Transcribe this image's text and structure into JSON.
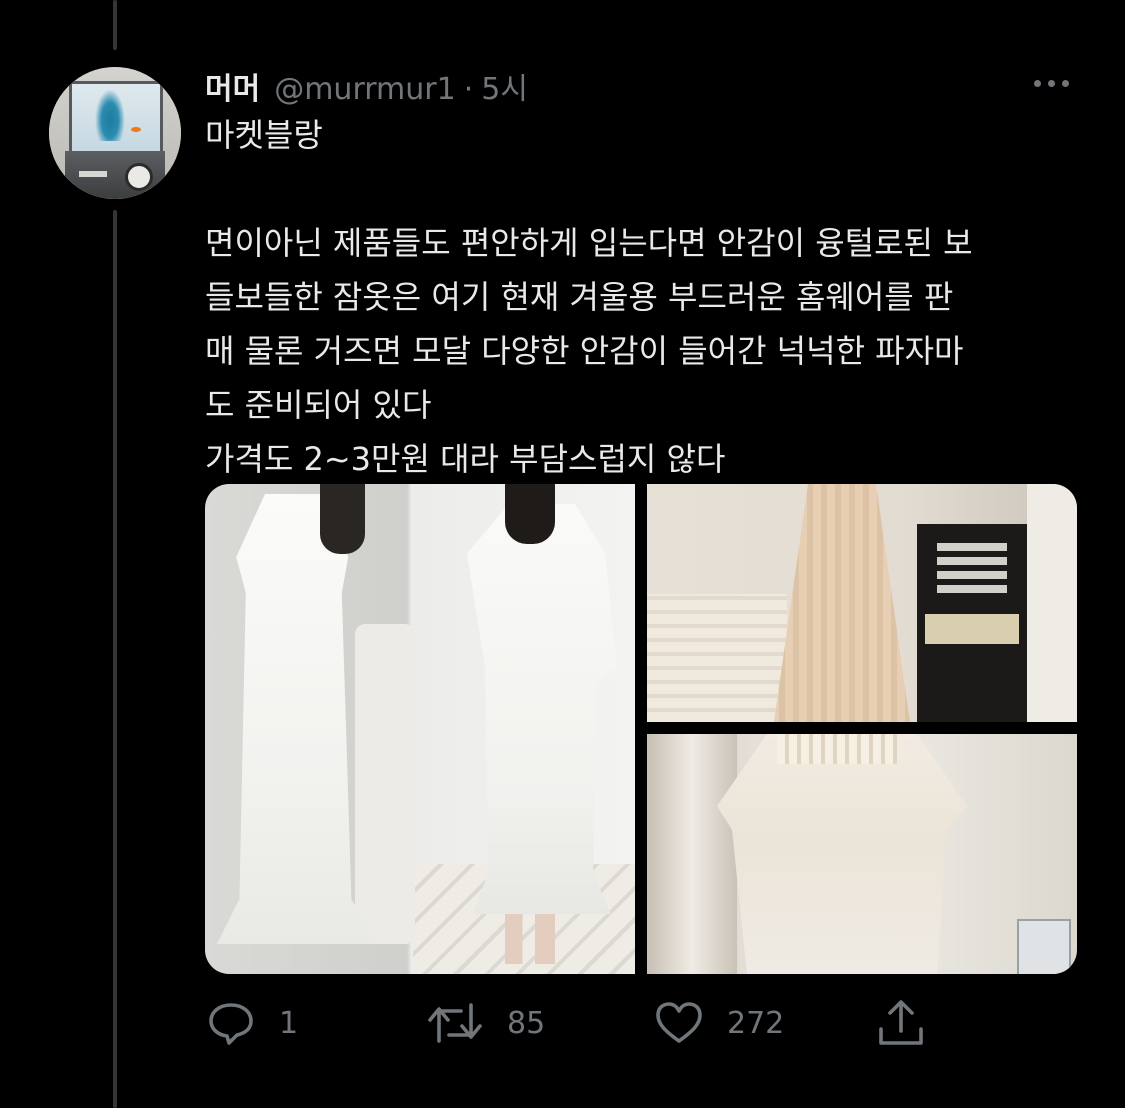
{
  "tweet": {
    "display_name": "머머",
    "handle": "@murrmur1",
    "separator": "·",
    "time": "5시",
    "lines": [
      "마켓블랑",
      "",
      "면이아닌 제품들도 편안하게 입는다면 안감이 융털로된 보",
      "들보들한 잠옷은 여기 현재 겨울용 부드러운 홈웨어를 판",
      "매 물론 거즈면 모달 다양한 안감이 들어간 넉넉한 파자마",
      "도 준비되어 있다",
      "가격도 2~3만원 대라 부담스럽지 않다"
    ],
    "photo_count": 3
  },
  "actions": {
    "reply_count": "1",
    "retweet_count": "85",
    "like_count": "272"
  },
  "icons": {
    "reply": "reply-bubble-icon",
    "retweet": "retweet-arrows-icon",
    "like": "heart-outline-icon",
    "share": "share-upload-icon",
    "more": "more-dots-icon"
  },
  "colors": {
    "background": "#000000",
    "text_primary": "#e7e9ea",
    "text_secondary": "#71767b",
    "thread_line": "#333639"
  }
}
